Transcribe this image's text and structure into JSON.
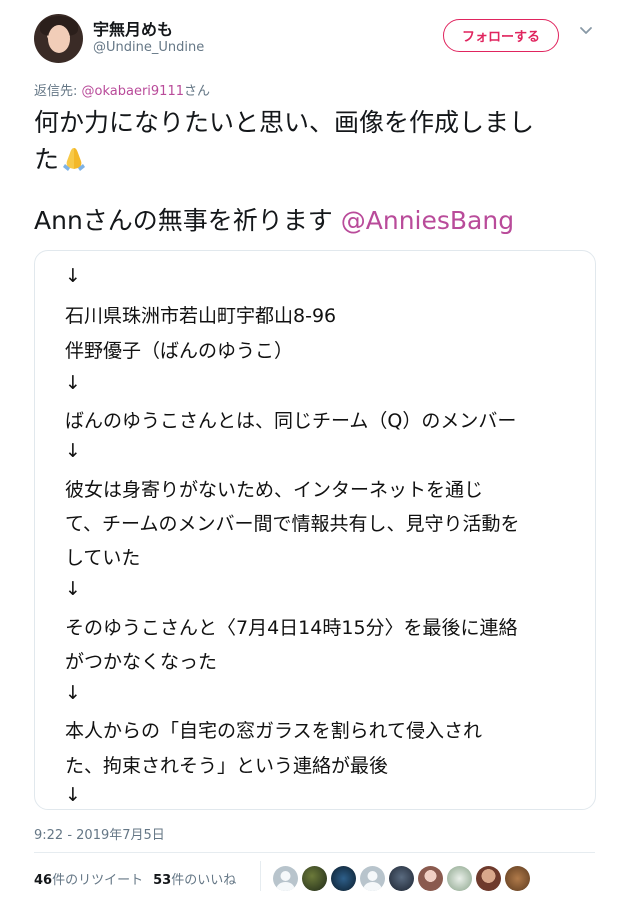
{
  "author": {
    "display_name": "宇無月めも",
    "handle": "@Undine_Undine"
  },
  "follow_button": {
    "label": "フォローする"
  },
  "reply": {
    "prefix": "返信先: ",
    "mention": "@okabaeri9111",
    "suffix": "さん"
  },
  "body": {
    "line1": "何か力になりたいと思い、画像を作成しまし",
    "line2": "た",
    "line3_text": "Annさんの無事を祈ります ",
    "line3_link": "@AnniesBang"
  },
  "image_text": [
    "↓",
    "石川県珠洲市若山町宇都山8-96",
    "伴野優子（ばんのゆうこ）",
    "↓",
    "ばんのゆうこさんとは、同じチーム（Q）のメンバー",
    "↓",
    "彼女は身寄りがないため、インターネットを通じ",
    "て、チームのメンバー間で情報共有し、見守り活動を",
    "していた",
    "↓",
    "そのゆうこさんと〈7月4日14時15分〉を最後に連絡",
    "がつかなくなった",
    "↓",
    "本人からの「自宅の窓ガラスを割られて侵入され",
    "た、拘束されそう」という連絡が最後",
    "↓"
  ],
  "timestamp": "9:22 - 2019年7月5日",
  "stats": {
    "retweets_count": "46",
    "retweets_label": "件のリツイート",
    "likes_count": "53",
    "likes_label": "件のいいね"
  },
  "icons": {
    "more": "chevron-down-icon",
    "emoji": "folded-hands-icon"
  },
  "colors": {
    "accent": "#e0245e",
    "link": "#b94b9a",
    "muted": "#657786"
  }
}
